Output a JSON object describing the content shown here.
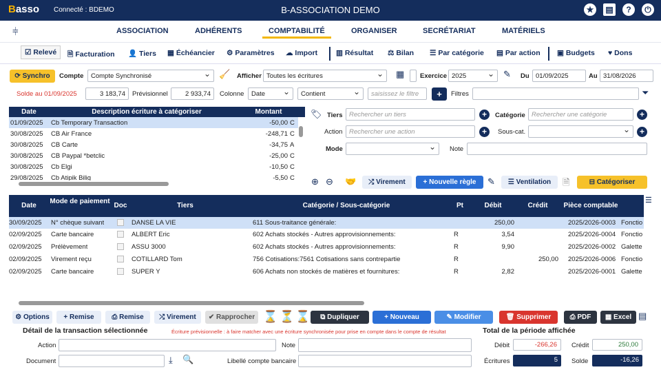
{
  "header": {
    "logo": "asso",
    "logo_x": "B",
    "connected": "Connecté : BDEMO",
    "title": "B-ASSOCIATION DEMO"
  },
  "mainnav": [
    "ASSOCIATION",
    "ADHÉRENTS",
    "COMPTABILITÉ",
    "ORGANISER",
    "SECRÉTARIAT",
    "MATÉRIELS"
  ],
  "subnav": [
    "Relevé",
    "Facturation",
    "Tiers",
    "Échéancier",
    "Paramètres",
    "Import",
    "Résultat",
    "Bilan",
    "Par catégorie",
    "Par action",
    "Budgets",
    "Dons"
  ],
  "filters": {
    "synchro": "Synchro",
    "compte_label": "Compte",
    "compte_value": "Compte Synchronisé",
    "afficher_label": "Afficher",
    "afficher_value": "Toutes les écritures",
    "exercice_label": "Exercice",
    "exercice_value": "2025",
    "du_label": "Du",
    "du_value": "01/09/2025",
    "au_label": "Au",
    "au_value": "31/08/2026",
    "solde_label": "Solde au 01/09/2025",
    "solde_value": "3 183,74",
    "prev_label": "Prévisionnel",
    "prev_value": "2 933,74",
    "colonne_label": "Colonne",
    "colonne_value": "Date",
    "contient_value": "Contient",
    "filtre_placeholder": "saisissez le filtre",
    "filtres_label": "Filtres"
  },
  "bank": {
    "headers": [
      "Date",
      "Description écriture à catégoriser",
      "Montant"
    ],
    "rows": [
      [
        "01/09/2025",
        "Cb Temporary Transaction",
        "-50,00",
        "C"
      ],
      [
        "30/08/2025",
        "CB Air France",
        "-248,71",
        "C"
      ],
      [
        "30/08/2025",
        "CB Carte",
        "-34,75",
        "A"
      ],
      [
        "30/08/2025",
        "CB Paypal *betclic",
        "-25,00",
        "C"
      ],
      [
        "30/08/2025",
        "Cb Elgi",
        "-10,50",
        "C"
      ],
      [
        "29/08/2025",
        "Cb Atipik Bilig",
        "-5,50",
        "C"
      ]
    ]
  },
  "categorize": {
    "tiers_label": "Tiers",
    "tiers_ph": "Rechercher un tiers",
    "categorie_label": "Catégorie",
    "categorie_ph": "Rechercher une catégorie",
    "action_label": "Action",
    "action_ph": "Rechercher une action",
    "souscat_label": "Sous-cat.",
    "mode_label": "Mode",
    "note_label": "Note",
    "virement": "Virement",
    "nouvelle_regle": "Nouvelle règle",
    "ventilation": "Ventilation",
    "categoriser": "Catégoriser"
  },
  "main": {
    "headers": [
      "Date",
      "Mode de paiement",
      "Doc",
      "Tiers",
      "Catégorie / Sous-catégorie",
      "Pt",
      "Débit",
      "Crédit",
      "Pièce comptable"
    ],
    "rows": [
      [
        "30/09/2025",
        "N° chèque suivant",
        "DANSE LA VIE",
        "611 Sous-traitance générale:",
        "",
        "250,00",
        "",
        "2025/2026-0003",
        "Fonctio"
      ],
      [
        "02/09/2025",
        "Carte bancaire",
        "ALBERT Eric",
        "602 Achats stockés - Autres approvisionnements:",
        "R",
        "3,54",
        "",
        "2025/2026-0004",
        "Fonctio"
      ],
      [
        "02/09/2025",
        "Prélèvement",
        "ASSU 3000",
        "602 Achats stockés - Autres approvisionnements:",
        "R",
        "9,90",
        "",
        "2025/2026-0002",
        "Galette"
      ],
      [
        "02/09/2025",
        "Virement reçu",
        "COTILLARD Tom",
        "756 Cotisations:7561 Cotisations sans contrepartie",
        "R",
        "",
        "250,00",
        "2025/2026-0006",
        "Fonctio"
      ],
      [
        "02/09/2025",
        "Carte bancaire",
        "SUPER Y",
        "606 Achats non stockés de matières et fournitures:",
        "R",
        "2,82",
        "",
        "2025/2026-0001",
        "Galette"
      ]
    ]
  },
  "actions": {
    "options": "Options",
    "remise1": "Remise",
    "remise2": "Remise",
    "virement": "Virement",
    "rapprocher": "Rapprocher",
    "dupliquer": "Dupliquer",
    "nouveau": "Nouveau",
    "modifier": "Modifier",
    "supprimer": "Supprimer",
    "pdf": "PDF",
    "excel": "Excel"
  },
  "detail": {
    "title": "Détail de la transaction sélectionnée",
    "note_red": "Écriture prévisionnelle : à faire matcher avec une écriture synchronisée pour prise en compte dans le compte de résultat",
    "action_label": "Action",
    "note_label": "Note",
    "document_label": "Document",
    "libelle_label": "Libellé compte bancaire"
  },
  "totals": {
    "title": "Total de la période affichée",
    "debit_label": "Débit",
    "debit_value": "-266,26",
    "credit_label": "Crédit",
    "credit_value": "250,00",
    "ecritures_label": "Écritures",
    "ecritures_value": "5",
    "solde_label": "Solde",
    "solde_value": "-16,26"
  }
}
